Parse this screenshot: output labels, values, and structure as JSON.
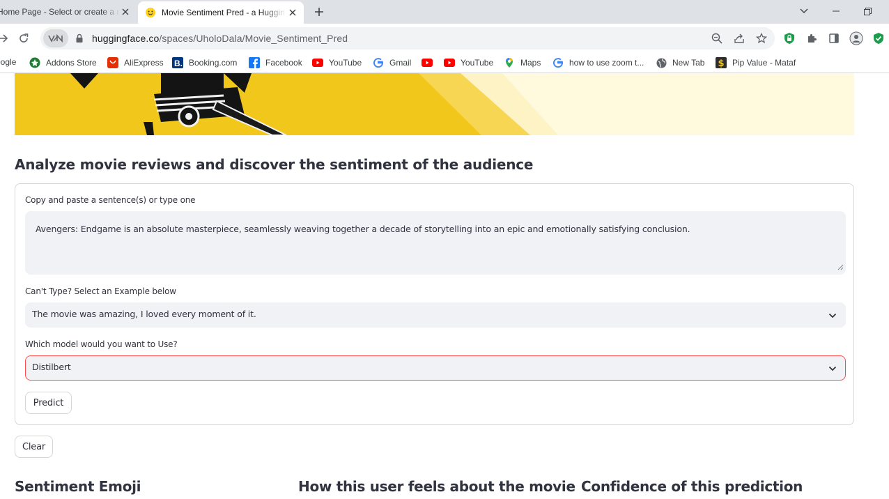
{
  "browser": {
    "tabs": [
      {
        "title": "Home Page - Select or create a n",
        "active": false
      },
      {
        "title": "Movie Sentiment Pred - a Huggin",
        "active": true
      }
    ],
    "url_host": "huggingface.co",
    "url_path": "/spaces/UholoDala/Movie_Sentiment_Pred",
    "bookmarks": [
      {
        "label": "oogle",
        "icon": "google-icon"
      },
      {
        "label": "Addons Store",
        "icon": "addons-icon"
      },
      {
        "label": "AliExpress",
        "icon": "aliexpress-icon"
      },
      {
        "label": "Booking.com",
        "icon": "booking-icon"
      },
      {
        "label": "Facebook",
        "icon": "facebook-icon"
      },
      {
        "label": "YouTube",
        "icon": "youtube-icon"
      },
      {
        "label": "Gmail",
        "icon": "google-icon"
      },
      {
        "label": "",
        "icon": "youtube-icon"
      },
      {
        "label": "YouTube",
        "icon": "youtube-icon"
      },
      {
        "label": "Maps",
        "icon": "maps-icon"
      },
      {
        "label": "how to use zoom t...",
        "icon": "google-icon"
      },
      {
        "label": "New Tab",
        "icon": "globe-icon"
      },
      {
        "label": "Pip Value - Mataf",
        "icon": "dollar-icon"
      }
    ]
  },
  "app": {
    "headline": "Analyze movie reviews and discover the sentiment of the audience",
    "input_label": "Copy and paste a sentence(s) or type one",
    "input_value": "Avengers: Endgame is an absolute masterpiece, seamlessly weaving together a decade of storytelling into an epic and emotionally satisfying conclusion.",
    "example_label": "Can't Type? Select an Example below",
    "example_value": "The movie was amazing, I loved every moment of it.",
    "model_label": "Which model would you want to Use?",
    "model_value": "Distilbert",
    "predict_label": "Predict",
    "clear_label": "Clear",
    "sections": {
      "emoji": "Sentiment Emoji",
      "feels": "How this user feels about the movie",
      "confidence": "Confidence of this prediction"
    }
  },
  "colors": {
    "accent": "#ff4b4b",
    "banner": "#f2c71b",
    "input_bg": "#f0f2f6"
  }
}
